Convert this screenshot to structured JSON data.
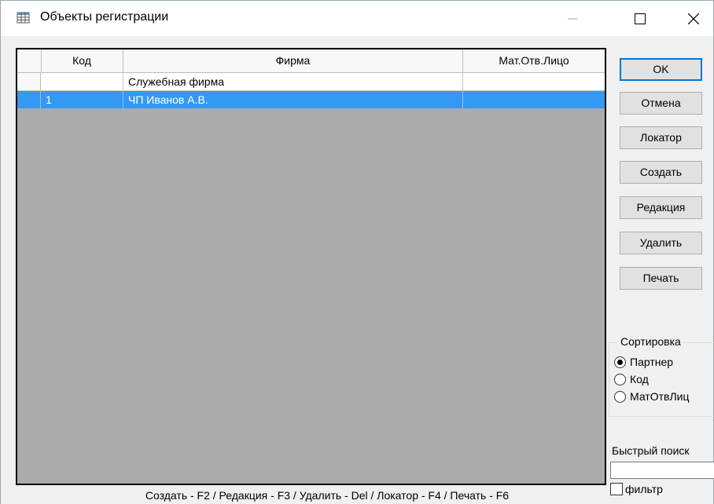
{
  "window": {
    "title": "Объекты регистрации",
    "minimize_glyph": "—",
    "maximize_glyph": "☐",
    "close_glyph": "✕",
    "icon": "table-grid-icon"
  },
  "grid": {
    "columns": [
      "Код",
      "Фирма",
      "Мат.Отв.Лицо"
    ],
    "rows": [
      {
        "code": "",
        "firm": "Служебная фирма",
        "person": "",
        "selected": false
      },
      {
        "code": "1",
        "firm": "ЧП Иванов А.В.",
        "person": "",
        "selected": true
      }
    ],
    "selection_color": "#3399f3"
  },
  "buttons": {
    "ok": "OK",
    "cancel": "Отмена",
    "locator": "Локатор",
    "create": "Создать",
    "edit": "Редакция",
    "delete": "Удалить",
    "print": "Печать"
  },
  "sort": {
    "legend": "Сортировка",
    "options": [
      "Партнер",
      "Код",
      "МатОтвЛиц"
    ],
    "selected": "Партнер"
  },
  "quick_search": {
    "label": "Быстрый поиск",
    "value": ""
  },
  "filter": {
    "label": "фильтр",
    "checked": false
  },
  "status_bar": {
    "text": "Создать - F2 / Редакция - F3 / Удалить - Del / Локатор - F4 / Печать - F6"
  }
}
